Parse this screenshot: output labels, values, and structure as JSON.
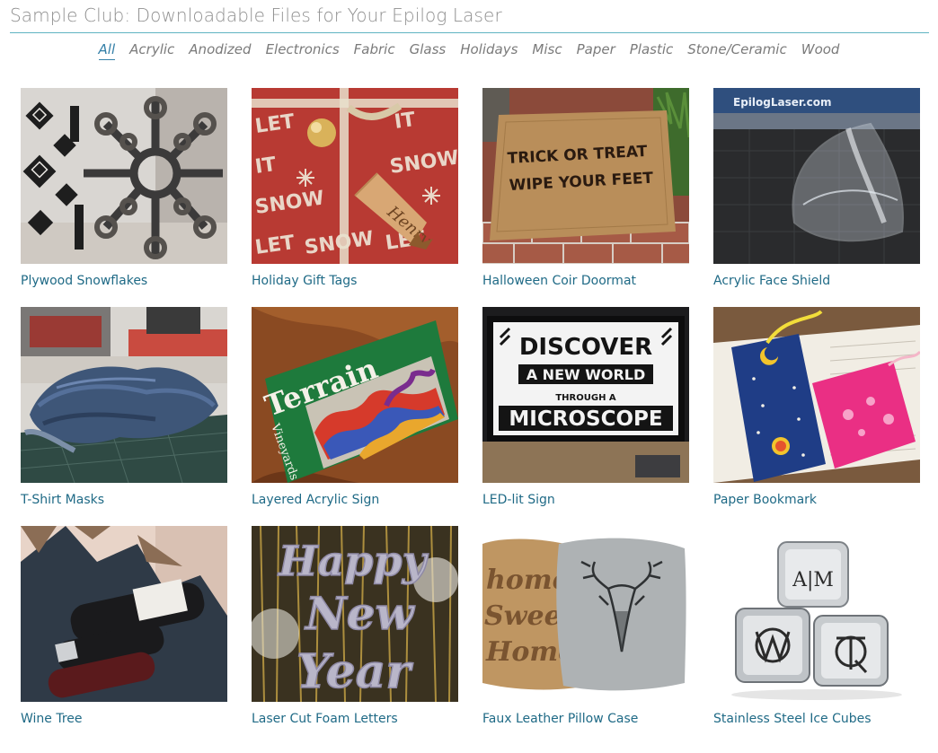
{
  "header": {
    "title": "Sample Club: Downloadable Files for Your Epilog Laser"
  },
  "filters": [
    {
      "label": "All",
      "active": true
    },
    {
      "label": "Acrylic"
    },
    {
      "label": "Anodized"
    },
    {
      "label": "Electronics"
    },
    {
      "label": "Fabric"
    },
    {
      "label": "Glass"
    },
    {
      "label": "Holidays"
    },
    {
      "label": "Misc"
    },
    {
      "label": "Paper"
    },
    {
      "label": "Plastic"
    },
    {
      "label": "Stone/Ceramic"
    },
    {
      "label": "Wood"
    }
  ],
  "items": [
    {
      "title": "Plywood Snowflakes"
    },
    {
      "title": "Holiday Gift Tags",
      "image_text": "Henry"
    },
    {
      "title": "Halloween Coir Doormat",
      "image_text": [
        "TRICK OR TREAT",
        "WIPE YOUR FEET"
      ]
    },
    {
      "title": "Acrylic Face Shield",
      "image_text": "EpilogLaser.com"
    },
    {
      "title": "T-Shirt Masks"
    },
    {
      "title": "Layered Acrylic Sign",
      "image_text": [
        "Terrain",
        "Vineyards"
      ]
    },
    {
      "title": "LED-lit Sign",
      "image_text": [
        "DISCOVER",
        "A NEW WORLD",
        "THROUGH A",
        "MICROSCOPE"
      ]
    },
    {
      "title": "Paper Bookmark"
    },
    {
      "title": "Wine Tree"
    },
    {
      "title": "Laser Cut Foam Letters",
      "image_text": [
        "Happy",
        "New",
        "Year"
      ]
    },
    {
      "title": "Faux Leather Pillow Case",
      "image_text": [
        "home",
        "Sweet",
        "Home"
      ]
    },
    {
      "title": "Stainless Steel Ice Cubes",
      "image_text": "A|M"
    }
  ]
}
